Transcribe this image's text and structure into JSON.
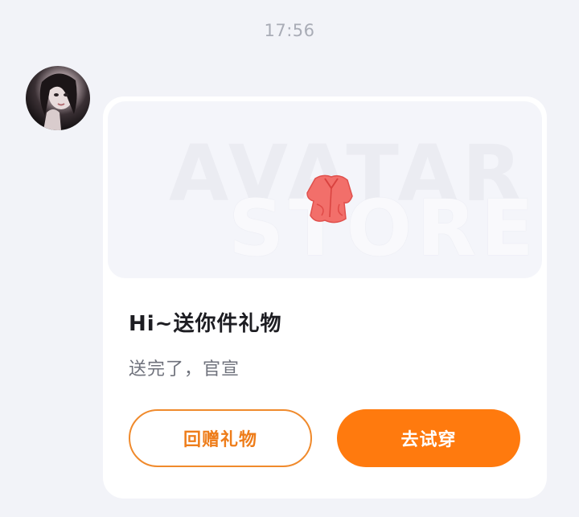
{
  "chat": {
    "timestamp": "17:56"
  },
  "message": {
    "sender_avatar": "user-avatar",
    "card": {
      "banner_watermark_line1": "AVATAR",
      "banner_watermark_line2": "STORE",
      "gift_icon": "red-shirt-icon",
      "title": "Hi~送你件礼物",
      "subtitle": "送完了，官宣",
      "buttons": {
        "return_gift": "回赠礼物",
        "try_on": "去试穿"
      }
    }
  },
  "colors": {
    "background": "#f2f3f8",
    "accent": "#ff7a0e",
    "outline_button": "#f08a2c",
    "gift": "#f26f6a"
  }
}
